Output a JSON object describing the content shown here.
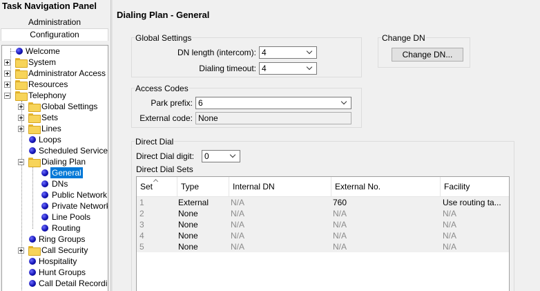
{
  "nav": {
    "panel_title": "Task Navigation Panel",
    "tab_admin": "Administration",
    "tab_config": "Configuration",
    "tree": {
      "welcome": "Welcome",
      "system": "System",
      "admin_access": "Administrator Access",
      "resources": "Resources",
      "telephony": "Telephony",
      "global_settings": "Global Settings",
      "sets": "Sets",
      "lines": "Lines",
      "loops": "Loops",
      "scheduled_services": "Scheduled Services",
      "dialing_plan": "Dialing Plan",
      "general": "General",
      "dns": "DNs",
      "public_network": "Public Network",
      "private_network": "Private Network",
      "line_pools": "Line Pools",
      "routing": "Routing",
      "ring_groups": "Ring Groups",
      "call_security": "Call Security",
      "hospitality": "Hospitality",
      "hunt_groups": "Hunt Groups",
      "call_detail_recording": "Call Detail Recording"
    }
  },
  "page": {
    "title": "Dialing Plan - General",
    "global_settings": {
      "title": "Global Settings",
      "dn_length_label": "DN length (intercom):",
      "dn_length_value": "4",
      "dialing_timeout_label": "Dialing timeout:",
      "dialing_timeout_value": "4"
    },
    "change_dn": {
      "title": "Change DN",
      "button": "Change DN..."
    },
    "access_codes": {
      "title": "Access Codes",
      "park_prefix_label": "Park prefix:",
      "park_prefix_value": "6",
      "external_code_label": "External code:",
      "external_code_value": "None"
    },
    "direct_dial": {
      "title": "Direct Dial",
      "digit_label": "Direct Dial digit:",
      "digit_value": "0",
      "sets_label": "Direct Dial Sets",
      "columns": [
        "Set",
        "Type",
        "Internal DN",
        "External No.",
        "Facility"
      ],
      "rows": [
        [
          "1",
          "External",
          "N/A",
          "760",
          "Use routing ta..."
        ],
        [
          "2",
          "None",
          "N/A",
          "N/A",
          "N/A"
        ],
        [
          "3",
          "None",
          "N/A",
          "N/A",
          "N/A"
        ],
        [
          "4",
          "None",
          "N/A",
          "N/A",
          "N/A"
        ],
        [
          "5",
          "None",
          "N/A",
          "N/A",
          "N/A"
        ]
      ]
    }
  }
}
